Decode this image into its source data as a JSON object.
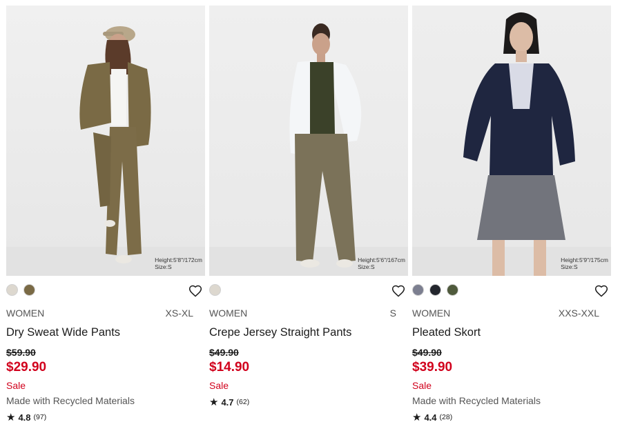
{
  "products": [
    {
      "model_height": "Height:5'8\"/172cm",
      "model_size": "Size:S",
      "swatches": [
        {
          "color": "#ddd8cf",
          "name": "off-white"
        },
        {
          "color": "#7a6a45",
          "name": "olive-brown"
        }
      ],
      "gender": "WOMEN",
      "sizes": "XS-XL",
      "name": "Dry Sweat Wide Pants",
      "old_price": "$59.90",
      "sale_price": "$29.90",
      "sale_label": "Sale",
      "tag": "Made with Recycled Materials",
      "rating_score": "4.8",
      "rating_count": "(97)",
      "outfit": {
        "top": "#7a6a45",
        "pants": "#7c6c48",
        "inner": "#f5f5f3",
        "cap": "#b8a78a"
      }
    },
    {
      "model_height": "Height:5'6\"/167cm",
      "model_size": "Size:S",
      "swatches": [
        {
          "color": "#ddd8cf",
          "name": "off-white"
        }
      ],
      "gender": "WOMEN",
      "sizes": "S",
      "name": "Crepe Jersey Straight Pants",
      "old_price": "$49.90",
      "sale_price": "$14.90",
      "sale_label": "Sale",
      "tag": "",
      "rating_score": "4.7",
      "rating_count": "(62)",
      "outfit": {
        "top": "#f4f6f8",
        "pants": "#7b7259",
        "inner": "#3b4129",
        "cap": ""
      }
    },
    {
      "model_height": "Height:5'9\"/175cm",
      "model_size": "Size:S",
      "swatches": [
        {
          "color": "#7c7f90",
          "name": "gray-blue"
        },
        {
          "color": "#23262d",
          "name": "navy-black"
        },
        {
          "color": "#4f5a3c",
          "name": "olive"
        }
      ],
      "gender": "WOMEN",
      "sizes": "XXS-XXL",
      "name": "Pleated Skort",
      "old_price": "$49.90",
      "sale_price": "$39.90",
      "sale_label": "Sale",
      "tag": "Made with Recycled Materials",
      "rating_score": "4.4",
      "rating_count": "(28)",
      "outfit": {
        "top": "#1f2640",
        "pants": "#72747c",
        "inner": "#d9dbe6",
        "cap": ""
      }
    }
  ],
  "icons": {
    "wishlist": "heart-outline-icon",
    "rating": "star-icon"
  },
  "colors": {
    "sale": "#d1001c",
    "text": "#1b1b1b",
    "muted": "#545454"
  }
}
